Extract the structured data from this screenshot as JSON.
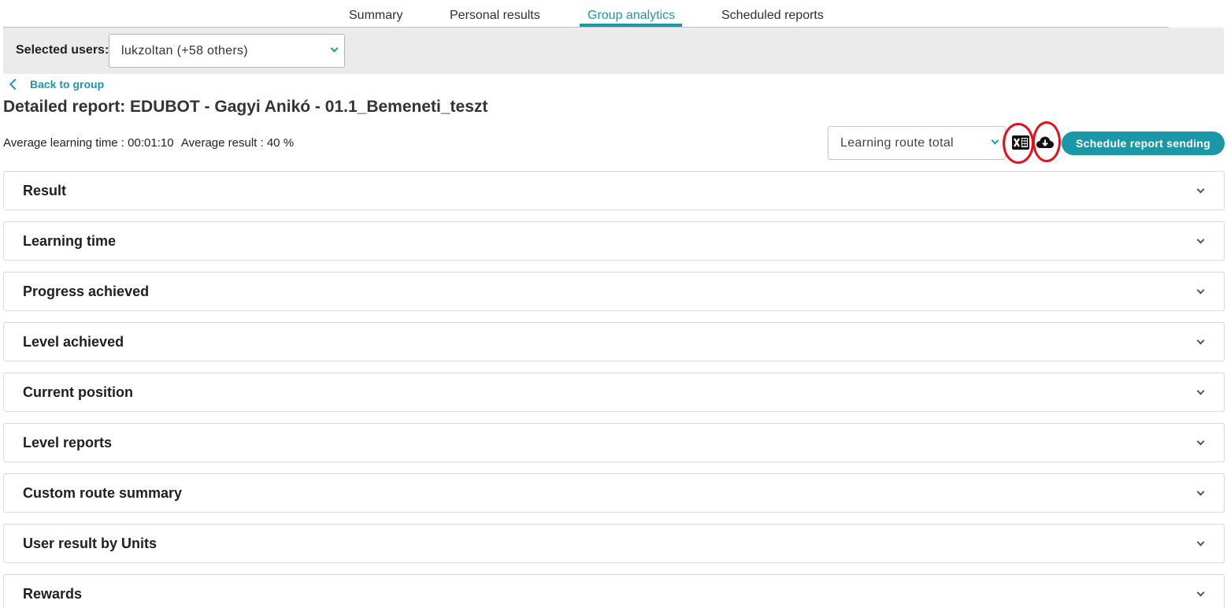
{
  "tabs": [
    {
      "label": "Summary"
    },
    {
      "label": "Personal results"
    },
    {
      "label": "Group analytics",
      "active": true
    },
    {
      "label": "Scheduled reports"
    }
  ],
  "users": {
    "label": "Selected users:",
    "value": "lukzoltan (+58 others)"
  },
  "back_link": "Back to group",
  "title": "Detailed report: EDUBOT - Gagyi Anikó - 01.1_Bemeneti_teszt",
  "stats": {
    "avg_time": "Average learning time : 00:01:10",
    "avg_result": "Average result : 40 %"
  },
  "route_select": {
    "value": "Learning route total"
  },
  "icons": {
    "excel": "excel-export-icon",
    "cloud": "cloud-download-icon"
  },
  "schedule_button": "Schedule report sending",
  "sections": [
    {
      "title": "Result"
    },
    {
      "title": "Learning time"
    },
    {
      "title": "Progress achieved"
    },
    {
      "title": "Level achieved"
    },
    {
      "title": "Current position"
    },
    {
      "title": "Level reports"
    },
    {
      "title": "Custom route summary"
    },
    {
      "title": "User result by Units"
    },
    {
      "title": "Rewards"
    }
  ],
  "colors": {
    "accent": "#1b98a8",
    "highlight": "#e3111b",
    "bar_bg": "#ebebeb"
  }
}
